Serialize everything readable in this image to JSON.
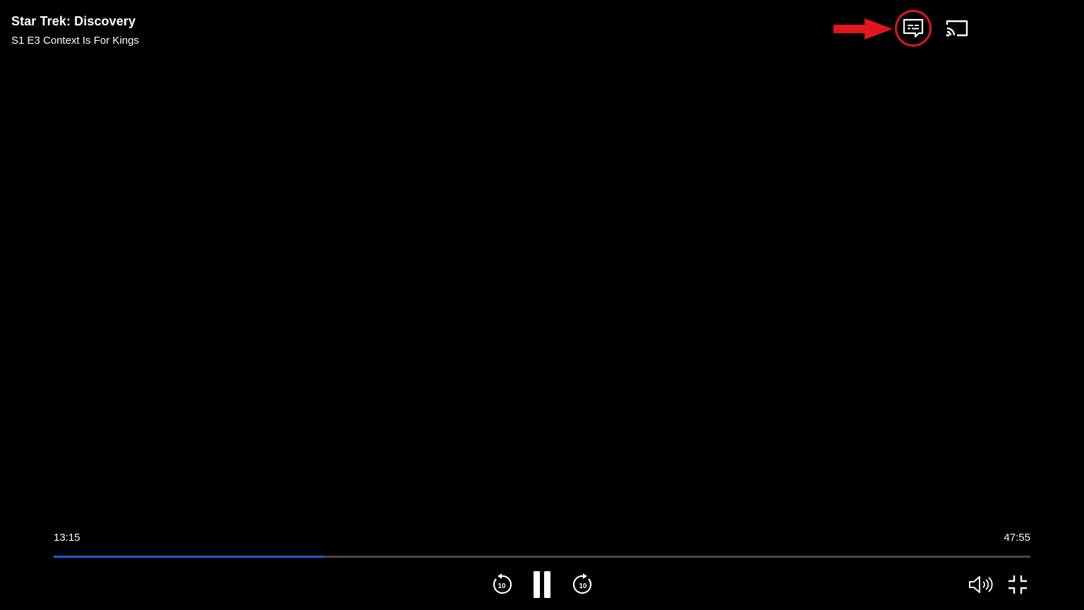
{
  "show": {
    "title": "Star Trek: Discovery",
    "episode": "S1 E3 Context Is For Kings"
  },
  "playback": {
    "current_time": "13:15",
    "total_time": "47:55",
    "progress_fraction": 0.2767
  },
  "controls": {
    "skip_back_seconds": "10",
    "skip_forward_seconds": "10",
    "icons": [
      "subtitles-icon",
      "cast-icon",
      "rewind-10-icon",
      "pause-icon",
      "forward-10-icon",
      "volume-icon",
      "exit-fullscreen-icon"
    ]
  },
  "annotation": {
    "highlight_color": "#e3161c",
    "target": "subtitles-button"
  },
  "colors": {
    "background": "#000000",
    "progress_played": "#0f64d2",
    "progress_track": "#4a4a4a",
    "text": "#ffffff"
  }
}
